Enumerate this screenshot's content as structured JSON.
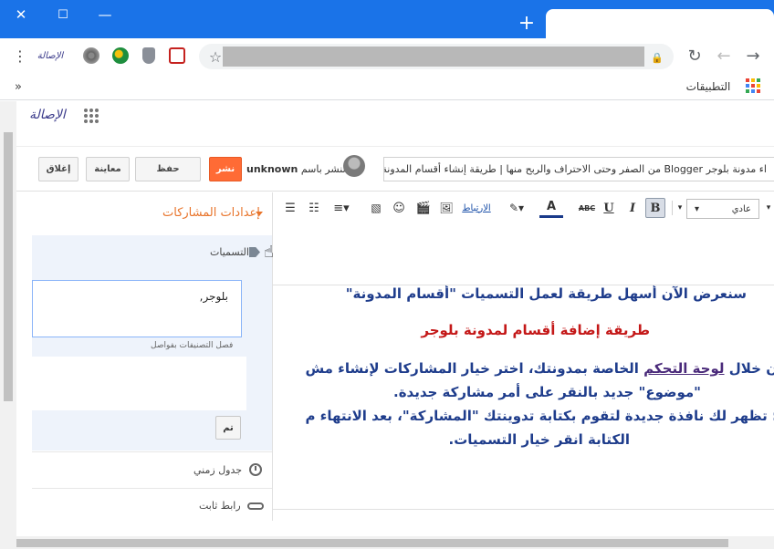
{
  "browser": {
    "close_glyph": "✕",
    "maximize_glyph": "☐",
    "minimize_glyph": "—",
    "new_tab_glyph": "+",
    "menu_glyph": "⋮",
    "ext_label": "الإصالة",
    "star_glyph": "☆",
    "lock_glyph": "🔒",
    "reload_glyph": "↻",
    "back_glyph": "←",
    "forward_glyph": "→",
    "bookmarks_overflow": "»",
    "apps_label": "التطبيقات",
    "colors": {
      "chrome_blue": "#1a73e8"
    }
  },
  "blogger": {
    "logo_text": "الإصالة",
    "buttons": {
      "close": "إغلاق",
      "preview": "معاينة",
      "save": "حفظ",
      "publish": "نشر"
    },
    "publish_as_prefix": "النشر باسم",
    "author": "unknown",
    "post_title": "اء مدونة بلوجر Blogger من الصفر وحتى الاحتراف والربح منها | طريقة إنشاء أقسام المدونة",
    "post_settings": "إعدادات المشاركات",
    "labels": {
      "heading": "التسميات",
      "value": "بلوجر,",
      "hint": "فصل التصنيفات بفواصل",
      "done": "تم"
    },
    "schedule": "جدول زمني",
    "permalink": "رابط ثابت",
    "editor": {
      "font_name": "عادي",
      "bold": "B",
      "italic": "I",
      "underline": "U",
      "strike": "ABC",
      "text_color": "A",
      "link": "الارتباط",
      "colors": {
        "publish": "#ff6b35",
        "accent": "#e8742b"
      }
    },
    "content": {
      "line1": "سنعرض الآن أسهل طريقة لعمل التسميات \"أقسام المدونة\"",
      "line2": "طريقة إضافة أقسام لمدونة بلوجر",
      "line3_prefix": "ن خلال ",
      "line3_link": "لوحة التحكم",
      "line3_suffix": " الخاصة بمدونتك، اختر خيار المشاركات لإنشاء مش",
      "line4": "\"موضوع\" جديد بالنقر على أمر مشاركة جديدة.",
      "line5": ": تظهر لك نافذة جديدة لتقوم بكتابة تدوينتك \"المشاركة\"، بعد الانتهاء م",
      "line6": "الكتابة انقر خيار التسميات."
    }
  }
}
